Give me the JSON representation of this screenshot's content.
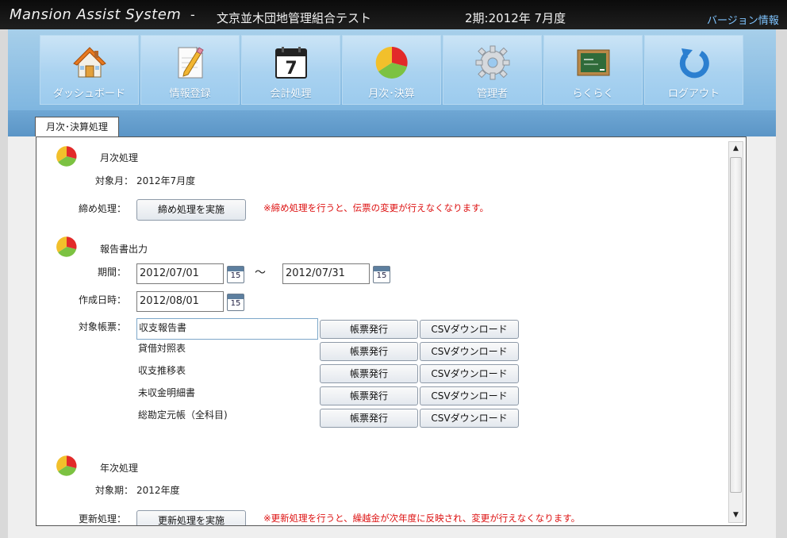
{
  "header": {
    "app_name": "Mansion Assist System",
    "separator": "-",
    "union_name": "文京並木団地管理組合テスト",
    "period": "2期:2012年 7月度",
    "version_link": "バージョン情報"
  },
  "nav": {
    "items": [
      {
        "label": "ダッシュボード",
        "icon": "house-icon"
      },
      {
        "label": "情報登録",
        "icon": "pencil-document-icon"
      },
      {
        "label": "会計処理",
        "icon": "calendar-icon"
      },
      {
        "label": "月次･決算",
        "icon": "pie-chart-icon"
      },
      {
        "label": "管理者",
        "icon": "gear-icon"
      },
      {
        "label": "らくらく",
        "icon": "chalkboard-icon"
      },
      {
        "label": "ログアウト",
        "icon": "logout-arrow-icon"
      }
    ]
  },
  "tab": {
    "label": "月次･決算処理"
  },
  "monthly": {
    "title": "月次処理",
    "target_label": "対象月：",
    "target_value": "2012年7月度",
    "close_label": "締め処理：",
    "close_button": "締め処理を実施",
    "warning": "※締め処理を行うと、伝票の変更が行えなくなります。"
  },
  "report": {
    "title": "報告書出力",
    "period_label": "期間：",
    "date_from": "2012/07/01",
    "tilde": "～",
    "date_to": "2012/07/31",
    "created_label": "作成日時：",
    "created_date": "2012/08/01",
    "forms_label": "対象帳票：",
    "calendar_day": "15",
    "issue_button": "帳票発行",
    "csv_button": "CSVダウンロード",
    "forms": [
      "収支報告書",
      "貸借対照表",
      "収支推移表",
      "未収金明細書",
      "総勘定元帳（全科目)"
    ]
  },
  "annual": {
    "title": "年次処理",
    "target_label": "対象期：",
    "target_value": "2012年度",
    "update_label": "更新処理：",
    "update_button": "更新処理を実施",
    "warning": "※更新処理を行うと、繰越金が次年度に反映され、変更が行えなくなります。"
  },
  "colors": {
    "accent_blue": "#7fb6e0",
    "warning_red": "#d11111",
    "titlebar": "#111111"
  }
}
